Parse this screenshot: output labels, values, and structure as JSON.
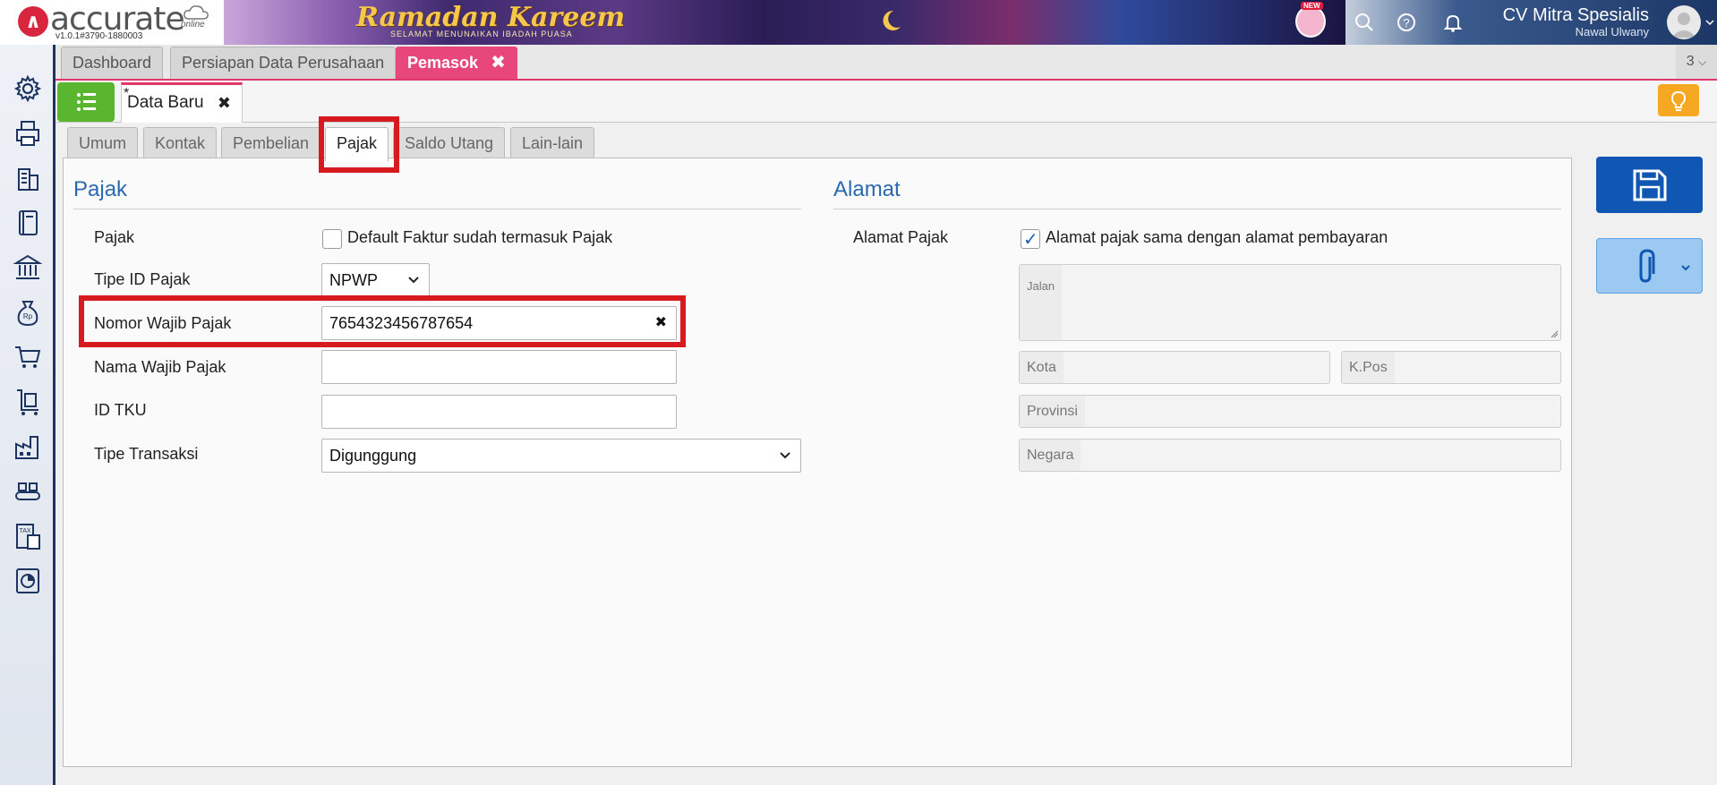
{
  "header": {
    "logo_text": "accurate",
    "logo_sub": "online",
    "version": "v1.0.1#3790-1880003",
    "banner_title": "Ramadan Kareem",
    "banner_sub": "SELAMAT MENUNAIKAN IBADAH PUASA",
    "new_badge": "NEW",
    "company": "CV Mitra Spesialis",
    "user": "Nawal Ulwany"
  },
  "sidebar": {
    "items": [
      {
        "icon": "gear-icon"
      },
      {
        "icon": "printer-icon"
      },
      {
        "icon": "building-icon"
      },
      {
        "icon": "book-icon"
      },
      {
        "icon": "bank-icon"
      },
      {
        "icon": "money-bag-icon"
      },
      {
        "icon": "cart-icon"
      },
      {
        "icon": "trolley-icon"
      },
      {
        "icon": "factory-icon"
      },
      {
        "icon": "conveyor-icon"
      },
      {
        "icon": "tax-icon"
      },
      {
        "icon": "report-icon"
      }
    ]
  },
  "page_tabs": {
    "tabs": [
      "Dashboard",
      "Persiapan Data Perusahaan",
      "Pemasok"
    ],
    "count": "3"
  },
  "document": {
    "modified_marker": "*",
    "title": "Data Baru"
  },
  "form_tabs": [
    "Umum",
    "Kontak",
    "Pembelian",
    "Pajak",
    "Saldo Utang",
    "Lain-lain"
  ],
  "pajak": {
    "section_title": "Pajak",
    "pajak_label": "Pajak",
    "default_faktur_label": "Default Faktur sudah termasuk Pajak",
    "default_faktur_checked": false,
    "tipe_id_label": "Tipe ID Pajak",
    "tipe_id_value": "NPWP",
    "nomor_label": "Nomor Wajib Pajak",
    "nomor_value": "7654323456787654",
    "nama_label": "Nama Wajib Pajak",
    "nama_value": "",
    "id_tku_label": "ID TKU",
    "id_tku_value": "",
    "tipe_transaksi_label": "Tipe Transaksi",
    "tipe_transaksi_value": "Digunggung"
  },
  "alamat": {
    "section_title": "Alamat",
    "alamat_pajak_label": "Alamat Pajak",
    "sama_label": "Alamat pajak sama dengan alamat pembayaran",
    "sama_checked": true,
    "jalan_placeholder": "Jalan",
    "kota_placeholder": "Kota",
    "kpos_placeholder": "K.Pos",
    "provinsi_placeholder": "Provinsi",
    "negara_placeholder": "Negara"
  },
  "colors": {
    "accent_pink": "#e8477b",
    "save_blue": "#0f57b3",
    "highlight_red": "#d71920",
    "list_green": "#5ab52f"
  }
}
